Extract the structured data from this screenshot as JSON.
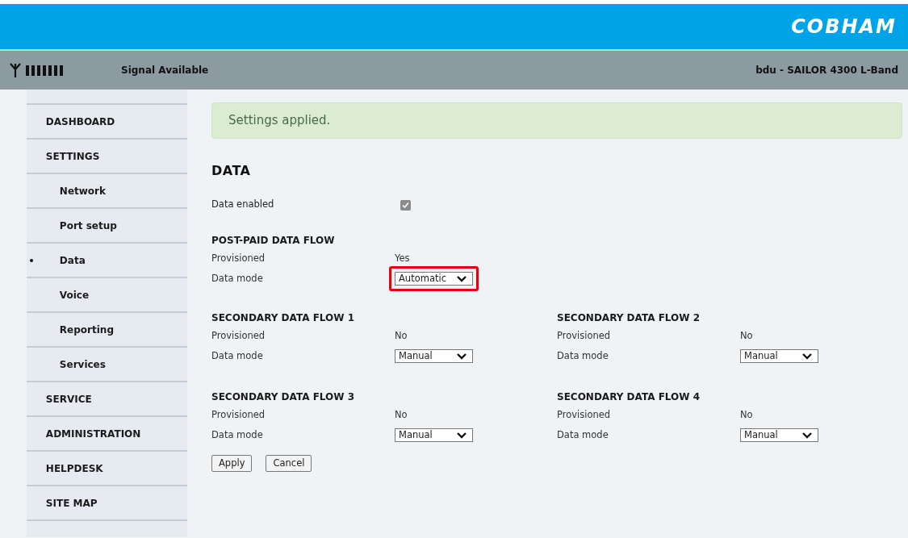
{
  "header": {
    "logo": "COBHAM",
    "signal_text": "Signal Available",
    "device": "bdu - SAILOR 4300 L-Band"
  },
  "sidebar": {
    "items": [
      {
        "label": "DASHBOARD",
        "selected": false
      },
      {
        "label": "SETTINGS",
        "selected": false,
        "children": [
          {
            "label": "Network",
            "selected": false
          },
          {
            "label": "Port setup",
            "selected": false
          },
          {
            "label": "Data",
            "selected": true
          },
          {
            "label": "Voice",
            "selected": false
          },
          {
            "label": "Reporting",
            "selected": false
          },
          {
            "label": "Services",
            "selected": false
          }
        ]
      },
      {
        "label": "SERVICE",
        "selected": false
      },
      {
        "label": "ADMINISTRATION",
        "selected": false
      },
      {
        "label": "HELPDESK",
        "selected": false
      },
      {
        "label": "SITE MAP",
        "selected": false
      }
    ]
  },
  "banner": "Settings applied.",
  "page_title": "DATA",
  "data_enabled": {
    "label": "Data enabled",
    "checked": true
  },
  "flows": [
    {
      "title": "POST-PAID DATA FLOW",
      "provisioned_label": "Provisioned",
      "provisioned_value": "Yes",
      "mode_label": "Data mode",
      "mode_value": "Automatic",
      "highlighted": true
    },
    {
      "title": "SECONDARY DATA FLOW 1",
      "provisioned_label": "Provisioned",
      "provisioned_value": "No",
      "mode_label": "Data mode",
      "mode_value": "Manual",
      "highlighted": false
    },
    {
      "title": "SECONDARY DATA FLOW 2",
      "provisioned_label": "Provisioned",
      "provisioned_value": "No",
      "mode_label": "Data mode",
      "mode_value": "Manual",
      "highlighted": false
    },
    {
      "title": "SECONDARY DATA FLOW 3",
      "provisioned_label": "Provisioned",
      "provisioned_value": "No",
      "mode_label": "Data mode",
      "mode_value": "Manual",
      "highlighted": false
    },
    {
      "title": "SECONDARY DATA FLOW 4",
      "provisioned_label": "Provisioned",
      "provisioned_value": "No",
      "mode_label": "Data mode",
      "mode_value": "Manual",
      "highlighted": false
    }
  ],
  "buttons": [
    "Apply",
    "Cancel"
  ]
}
